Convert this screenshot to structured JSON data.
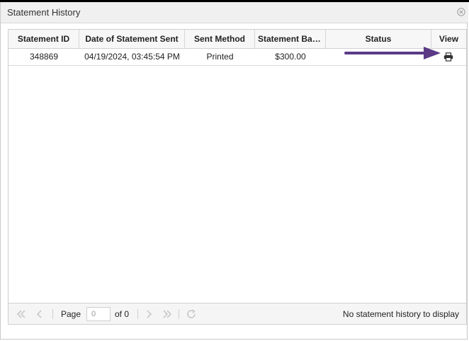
{
  "dialog": {
    "title": "Statement History"
  },
  "table": {
    "columns": [
      {
        "key": "statement_id",
        "label": "Statement ID"
      },
      {
        "key": "date_sent",
        "label": "Date of Statement Sent"
      },
      {
        "key": "sent_method",
        "label": "Sent Method"
      },
      {
        "key": "balance",
        "label": "Statement Bal…"
      },
      {
        "key": "status",
        "label": "Status"
      },
      {
        "key": "view",
        "label": "View"
      }
    ],
    "rows": [
      {
        "statement_id": "348869",
        "date_sent": "04/19/2024, 03:45:54 PM",
        "sent_method": "Printed",
        "balance": "$300.00",
        "status": "",
        "view_icon": "print-icon"
      }
    ]
  },
  "annotation": {
    "arrow_color": "#5b3a86"
  },
  "pager": {
    "page_label": "Page",
    "page_value": "0",
    "of_label": "of 0",
    "status_text": "No statement history to display"
  }
}
